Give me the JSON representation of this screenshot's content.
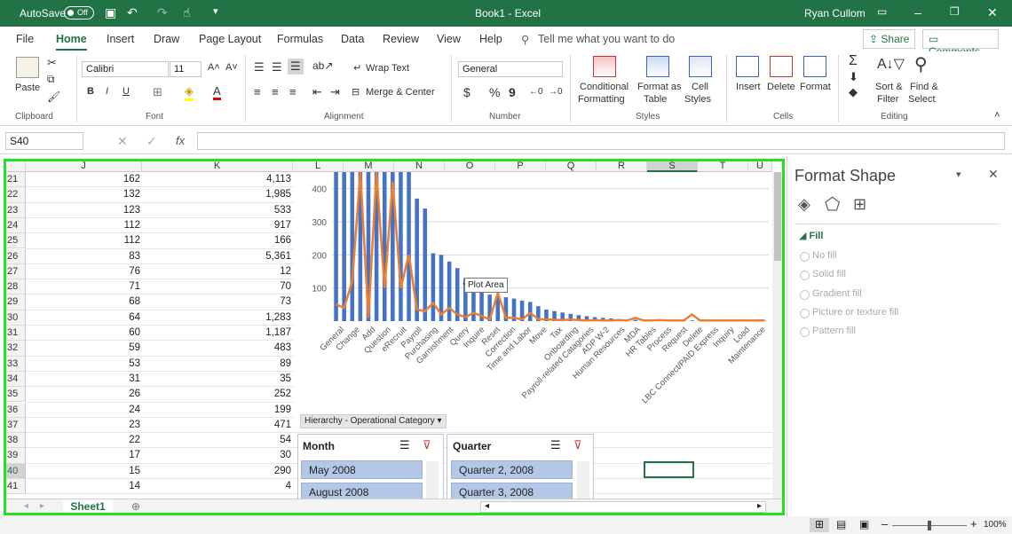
{
  "titlebar": {
    "autosave": "AutoSave",
    "autosave_state": "Off",
    "doc_title": "Book1  -  Excel",
    "user": "Ryan Cullom"
  },
  "tabs": [
    "File",
    "Home",
    "Insert",
    "Draw",
    "Page Layout",
    "Formulas",
    "Data",
    "Review",
    "View",
    "Help"
  ],
  "tell_me": "Tell me what you want to do",
  "share": "Share",
  "comments": "Comments",
  "ribbon": {
    "clipboard": {
      "paste": "Paste",
      "group": "Clipboard"
    },
    "font": {
      "name": "Calibri",
      "size": "11",
      "group": "Font",
      "bold": "B",
      "italic": "I",
      "underline": "U",
      "grow": "A˄",
      "shrink": "A˅"
    },
    "alignment": {
      "wrap": "Wrap Text",
      "merge": "Merge & Center",
      "group": "Alignment"
    },
    "number": {
      "format": "General",
      "currency": "$",
      "percent": "%",
      "comma": "9",
      "group": "Number"
    },
    "styles": {
      "cond1": "Conditional",
      "cond2": "Formatting",
      "fmt1": "Format as",
      "fmt2": "Table",
      "cell1": "Cell",
      "cell2": "Styles",
      "group": "Styles"
    },
    "cells": {
      "insert": "Insert",
      "delete": "Delete",
      "format": "Format",
      "group": "Cells"
    },
    "editing": {
      "sort1": "Sort &",
      "sort2": "Filter",
      "find1": "Find &",
      "find2": "Select",
      "group": "Editing"
    }
  },
  "formula_bar": {
    "namebox": "S40",
    "fx": "fx",
    "value": ""
  },
  "columns": [
    "J",
    "K",
    "L",
    "M",
    "N",
    "O",
    "P",
    "Q",
    "R",
    "S",
    "T",
    "U"
  ],
  "rows": [
    {
      "n": "21",
      "j": "162",
      "k": "4,113"
    },
    {
      "n": "22",
      "j": "132",
      "k": "1,985"
    },
    {
      "n": "23",
      "j": "123",
      "k": "533"
    },
    {
      "n": "24",
      "j": "112",
      "k": "917"
    },
    {
      "n": "25",
      "j": "112",
      "k": "166"
    },
    {
      "n": "26",
      "j": "83",
      "k": "5,361"
    },
    {
      "n": "27",
      "j": "76",
      "k": "12"
    },
    {
      "n": "28",
      "j": "71",
      "k": "70"
    },
    {
      "n": "29",
      "j": "68",
      "k": "73"
    },
    {
      "n": "30",
      "j": "64",
      "k": "1,283"
    },
    {
      "n": "31",
      "j": "60",
      "k": "1,187"
    },
    {
      "n": "32",
      "j": "59",
      "k": "483"
    },
    {
      "n": "33",
      "j": "53",
      "k": "89"
    },
    {
      "n": "34",
      "j": "31",
      "k": "35"
    },
    {
      "n": "35",
      "j": "26",
      "k": "252"
    },
    {
      "n": "36",
      "j": "24",
      "k": "199"
    },
    {
      "n": "37",
      "j": "23",
      "k": "471"
    },
    {
      "n": "38",
      "j": "22",
      "k": "54"
    },
    {
      "n": "39",
      "j": "17",
      "k": "30"
    },
    {
      "n": "40",
      "j": "15",
      "k": "290"
    },
    {
      "n": "41",
      "j": "14",
      "k": "4"
    }
  ],
  "chart_data": {
    "type": "bar",
    "ylim": [
      0,
      450
    ],
    "yticks": [
      "100",
      "200",
      "300",
      "400"
    ],
    "categories": [
      "General",
      "Change",
      "Add",
      "Question",
      "eRecruit",
      "Payroll",
      "Purchasing",
      "Garnishment",
      "Query",
      "Inquire",
      "Reset",
      "Correction",
      "Time and Labor",
      "Move",
      "Tax",
      "Onboarding",
      "Payroll-related Catagories",
      "ADP W-2",
      "Human Resources",
      "MDA",
      "HR Tables",
      "Process",
      "Request",
      "Delete",
      "LBC Connect/PAID Express",
      "Inquiry",
      "Load",
      "Maintenance"
    ],
    "bar_values": [
      450,
      450,
      450,
      450,
      450,
      450,
      450,
      450,
      450,
      450,
      370,
      340,
      205,
      200,
      180,
      160,
      130,
      120,
      115,
      80,
      75,
      72,
      68,
      62,
      58,
      45,
      35,
      30,
      26,
      22,
      18,
      15,
      12,
      10,
      8,
      6,
      5,
      4,
      4,
      3,
      3,
      2,
      2,
      2,
      2,
      1,
      1,
      1,
      1,
      1,
      1,
      1,
      1,
      1
    ],
    "line_values": [
      50,
      40,
      120,
      450,
      10,
      450,
      100,
      420,
      100,
      200,
      35,
      30,
      55,
      20,
      40,
      20,
      12,
      25,
      15,
      5,
      85,
      10,
      10,
      5,
      25,
      6,
      5,
      4,
      3,
      5,
      3,
      2,
      3,
      2,
      2,
      3,
      2,
      10,
      2,
      2,
      3,
      2,
      2,
      2,
      20,
      2,
      2,
      2,
      2,
      2,
      2,
      2,
      2,
      2
    ],
    "bar_color": "#4472c4",
    "line_color": "#ed7d31"
  },
  "tooltip": "Plot Area",
  "pivot_field": "Hierarchy - Operational Category",
  "slicers": [
    {
      "title": "Month",
      "items": [
        "May 2008",
        "August 2008"
      ]
    },
    {
      "title": "Quarter",
      "items": [
        "Quarter 2, 2008",
        "Quarter 3, 2008"
      ]
    }
  ],
  "sheet_tab": "Sheet1",
  "format_pane": {
    "title": "Format Shape",
    "section": "Fill",
    "options": [
      "No fill",
      "Solid fill",
      "Gradient fill",
      "Picture or texture fill",
      "Pattern fill"
    ]
  },
  "zoom": "100%",
  "colors": {
    "excel_green": "#217346",
    "highlight": "#22e022"
  }
}
